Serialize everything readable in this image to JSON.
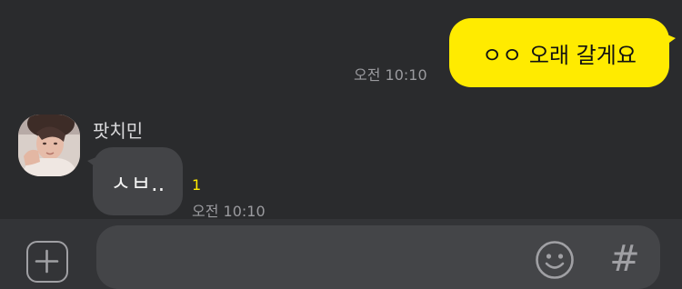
{
  "messages": {
    "outgoing": {
      "text": "ㅇㅇ 오래 갈게요",
      "time": "오전 10:10"
    },
    "incoming": {
      "sender": "팟치민",
      "text": "ㅅㅂ..",
      "unread": "1",
      "time": "오전 10:10"
    }
  },
  "input_bar": {
    "add_icon": "plus-square-icon",
    "emoji_icon": "smile-face-icon",
    "hash_label": "#"
  },
  "colors": {
    "background": "#2a2b2d",
    "outgoing_bubble": "#ffeb00",
    "incoming_bubble": "#434447",
    "unread": "#ffeb00"
  }
}
